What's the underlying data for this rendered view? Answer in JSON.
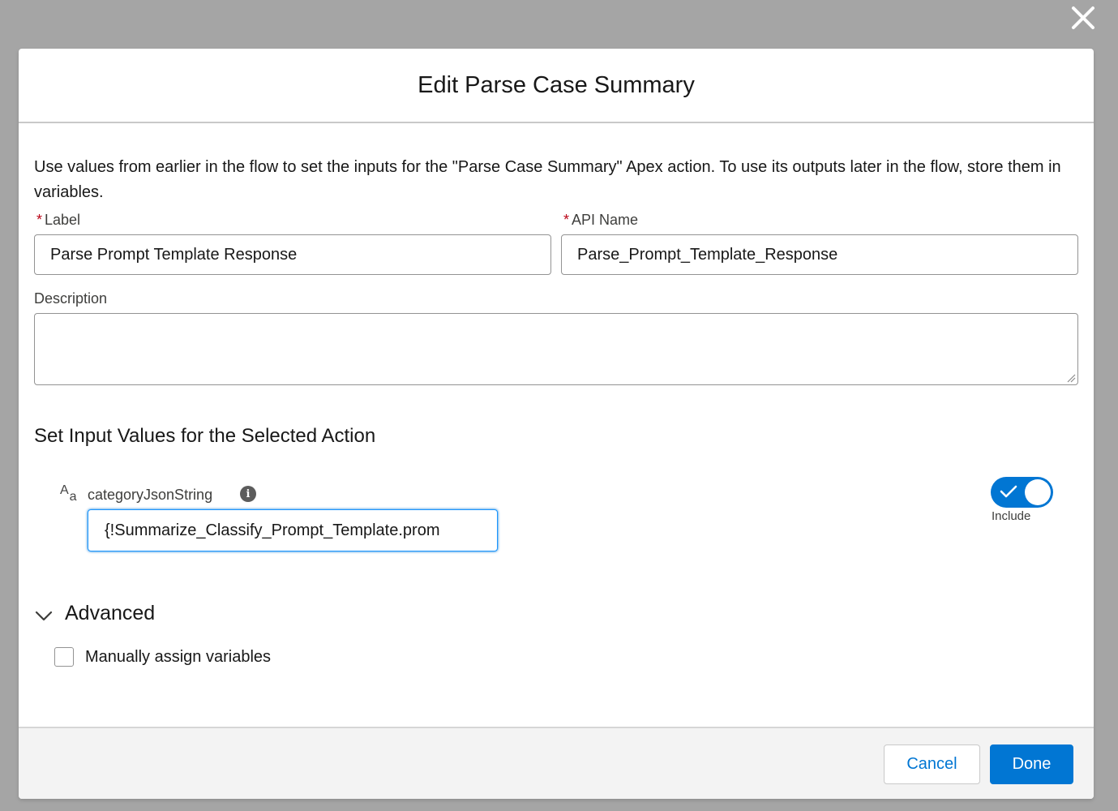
{
  "modal": {
    "title": "Edit Parse Case Summary",
    "intro": "Use values from earlier in the flow to set the inputs for the \"Parse Case Summary\" Apex action. To use its outputs later in the flow, store them in variables.",
    "required_marker": "*",
    "label_field": {
      "label": "Label",
      "value": "Parse Prompt Template Response"
    },
    "api_name_field": {
      "label": "API Name",
      "value": "Parse_Prompt_Template_Response"
    },
    "description_field": {
      "label": "Description",
      "value": ""
    }
  },
  "inputs_section": {
    "title": "Set Input Values for the Selected Action",
    "type_icon": {
      "name": "text-type-icon",
      "big": "A",
      "small": "a"
    },
    "param_label": "categoryJsonString",
    "info_icon_glyph": "i",
    "param_value": "{!Summarize_Classify_Prompt_Template.prom",
    "include_toggle": {
      "checked": true,
      "caption": "Include"
    }
  },
  "advanced": {
    "title": "Advanced",
    "expanded": true,
    "manual_assign": {
      "label": "Manually assign variables",
      "checked": false
    }
  },
  "footer": {
    "cancel_label": "Cancel",
    "done_label": "Done"
  },
  "colors": {
    "overlay": "#a5a5a5",
    "brand": "#0176d3",
    "required": "#ba0517"
  }
}
